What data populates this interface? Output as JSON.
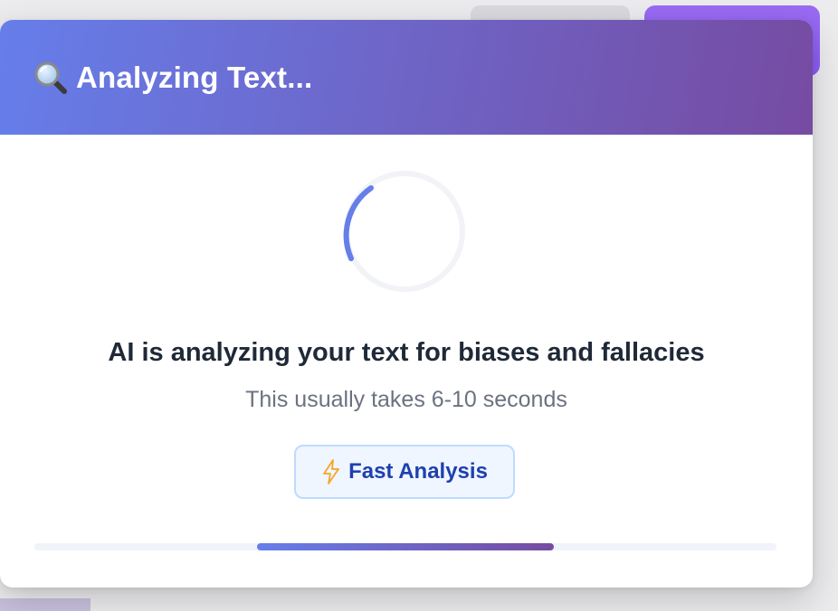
{
  "modal": {
    "title": "Analyzing Text...",
    "header_icon": "magnifier-icon"
  },
  "status": {
    "main_text": "AI is analyzing your text for biases and fallacies",
    "sub_text": "This usually takes 6-10 seconds"
  },
  "badge": {
    "icon": "lightning-icon",
    "label": "Fast Analysis"
  },
  "progress": {
    "indeterminate": true,
    "segment_start": 0.3,
    "segment_end": 0.7
  },
  "colors": {
    "header_gradient_start": "#667eea",
    "header_gradient_end": "#764ba2",
    "badge_bg": "#eff6ff",
    "badge_border": "#bfdbfe",
    "badge_text": "#1e40af",
    "spinner_arc": "#667eea",
    "background_button": "#8b5cf6"
  }
}
